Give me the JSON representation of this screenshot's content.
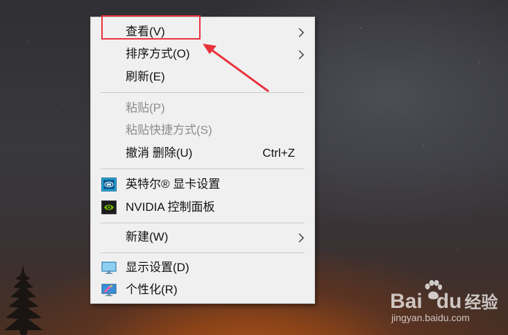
{
  "context_menu": {
    "items": [
      {
        "label": "查看(V)",
        "has_submenu": true
      },
      {
        "label": "排序方式(O)",
        "has_submenu": true
      },
      {
        "label": "刷新(E)"
      },
      {
        "label": "粘贴(P)",
        "disabled": true
      },
      {
        "label": "粘贴快捷方式(S)",
        "disabled": true
      },
      {
        "label": "撤消 删除(U)",
        "shortcut": "Ctrl+Z"
      },
      {
        "label": "英特尔® 显卡设置",
        "icon": "intel-graphics-icon"
      },
      {
        "label": "NVIDIA 控制面板",
        "icon": "nvidia-icon"
      },
      {
        "label": "新建(W)",
        "has_submenu": true
      },
      {
        "label": "显示设置(D)",
        "icon": "display-settings-icon"
      },
      {
        "label": "个性化(R)",
        "icon": "personalize-icon"
      }
    ]
  },
  "annotation": {
    "color": "#e8323c",
    "highlighted_item": "查看(V)"
  },
  "watermark": {
    "logo_left": "Bai",
    "logo_right": "du",
    "logo_suffix": "经验",
    "url": "jingyan.baidu.com"
  }
}
